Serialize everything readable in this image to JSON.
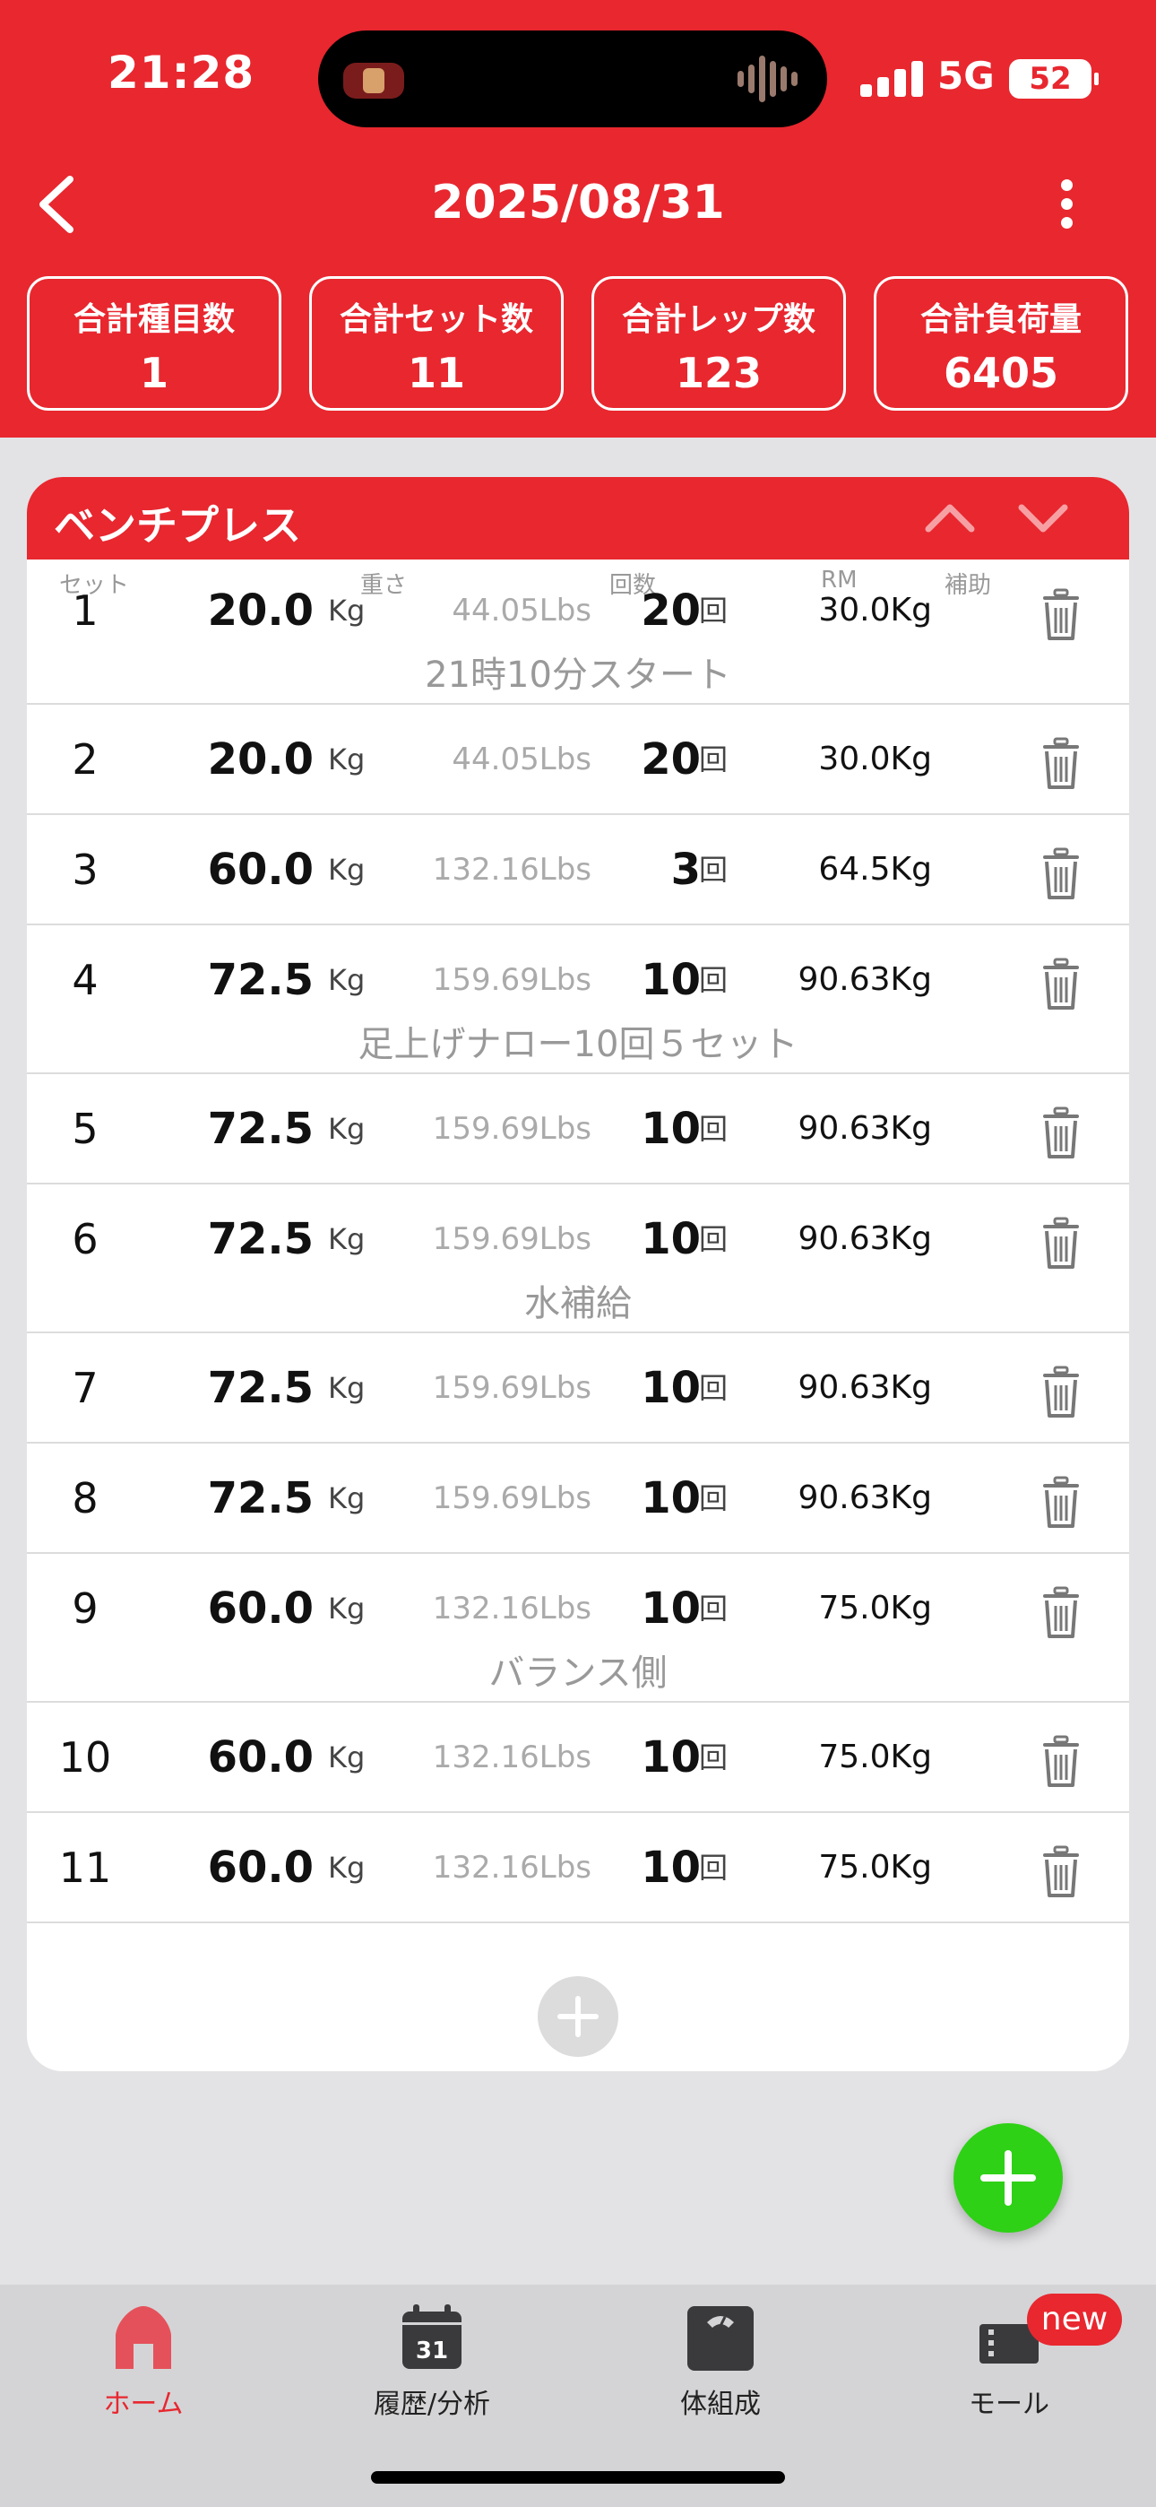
{
  "status_bar": {
    "time": "21:28",
    "network": "5G",
    "battery": "52"
  },
  "nav": {
    "title": "2025/08/31"
  },
  "stats": [
    {
      "label": "合計種目数",
      "value": "1"
    },
    {
      "label": "合計セット数",
      "value": "11"
    },
    {
      "label": "合計レップ数",
      "value": "123"
    },
    {
      "label": "合計負荷量",
      "value": "6405"
    }
  ],
  "exercise": {
    "name": "ベンチプレス",
    "columns": {
      "set": "セット",
      "weight": "重さ",
      "reps": "回数",
      "rm": "RM",
      "assist": "補助"
    },
    "weight_unit": "Kg",
    "reps_unit": "回",
    "sets": [
      {
        "num": "1",
        "weight": "20.0",
        "lbs": "44.05Lbs",
        "reps": "20",
        "rm": "30.0Kg",
        "memo": "21時10分スタート"
      },
      {
        "num": "2",
        "weight": "20.0",
        "lbs": "44.05Lbs",
        "reps": "20",
        "rm": "30.0Kg",
        "memo": ""
      },
      {
        "num": "3",
        "weight": "60.0",
        "lbs": "132.16Lbs",
        "reps": "3",
        "rm": "64.5Kg",
        "memo": ""
      },
      {
        "num": "4",
        "weight": "72.5",
        "lbs": "159.69Lbs",
        "reps": "10",
        "rm": "90.63Kg",
        "memo": "足上げナロー10回５セット"
      },
      {
        "num": "5",
        "weight": "72.5",
        "lbs": "159.69Lbs",
        "reps": "10",
        "rm": "90.63Kg",
        "memo": ""
      },
      {
        "num": "6",
        "weight": "72.5",
        "lbs": "159.69Lbs",
        "reps": "10",
        "rm": "90.63Kg",
        "memo": "水補給"
      },
      {
        "num": "7",
        "weight": "72.5",
        "lbs": "159.69Lbs",
        "reps": "10",
        "rm": "90.63Kg",
        "memo": ""
      },
      {
        "num": "8",
        "weight": "72.5",
        "lbs": "159.69Lbs",
        "reps": "10",
        "rm": "90.63Kg",
        "memo": ""
      },
      {
        "num": "9",
        "weight": "60.0",
        "lbs": "132.16Lbs",
        "reps": "10",
        "rm": "75.0Kg",
        "memo": "バランス側"
      },
      {
        "num": "10",
        "weight": "60.0",
        "lbs": "132.16Lbs",
        "reps": "10",
        "rm": "75.0Kg",
        "memo": ""
      },
      {
        "num": "11",
        "weight": "60.0",
        "lbs": "132.16Lbs",
        "reps": "10",
        "rm": "75.0Kg",
        "memo": ""
      }
    ]
  },
  "tabbar": {
    "items": [
      {
        "label": "ホーム",
        "icon": "home-icon",
        "active": true
      },
      {
        "label": "履歴/分析",
        "icon": "calendar-icon",
        "calendar_day": "31"
      },
      {
        "label": "体組成",
        "icon": "scale-icon"
      },
      {
        "label": "モール",
        "icon": "store-icon",
        "badge": "new"
      }
    ]
  },
  "colors": {
    "primary": "#e8272f",
    "fab": "#2ed116",
    "muted": "#999999"
  }
}
